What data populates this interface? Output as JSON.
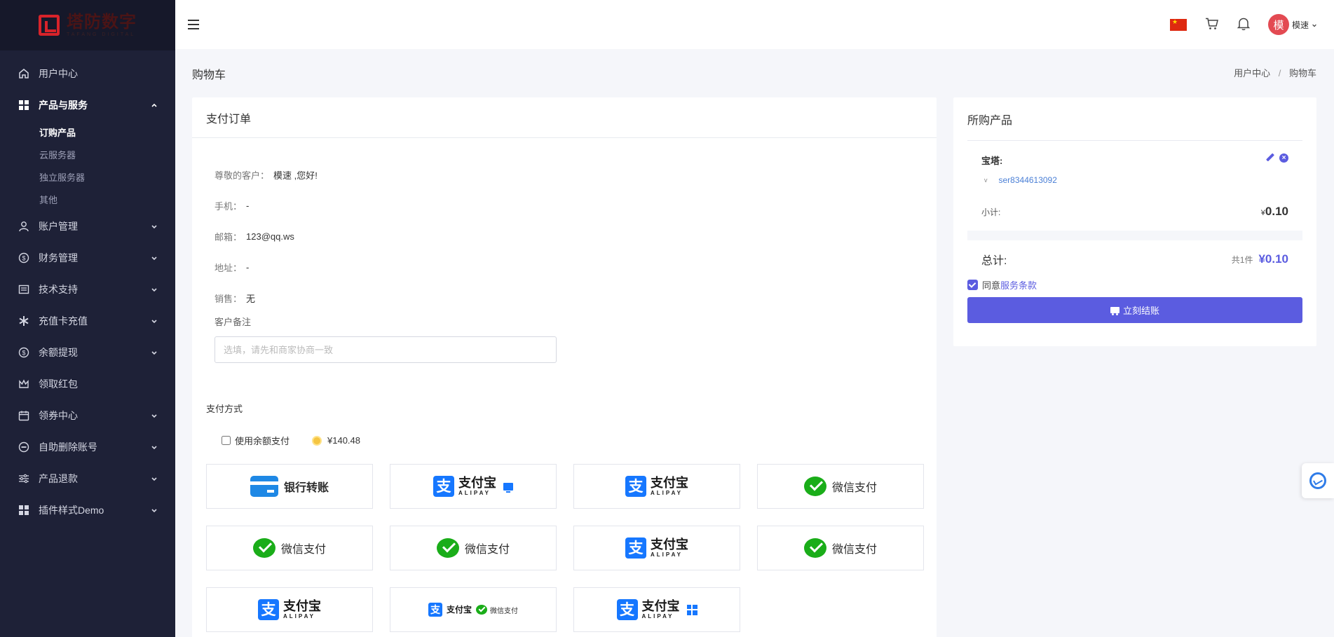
{
  "sidebar": {
    "logo_text": "塔防数字",
    "logo_sub": "TAFANG DIGITAL",
    "items": [
      {
        "label": "用户中心",
        "icon": "home-icon"
      },
      {
        "label": "产品与服务",
        "icon": "grid-icon"
      },
      {
        "label": "账户管理",
        "icon": "user-icon"
      },
      {
        "label": "财务管理",
        "icon": "dollar-icon"
      },
      {
        "label": "技术支持",
        "icon": "ticket-icon"
      },
      {
        "label": "充值卡充值",
        "icon": "asterisk-icon"
      },
      {
        "label": "余额提现",
        "icon": "dollar-icon"
      },
      {
        "label": "领取红包",
        "icon": "crown-icon"
      },
      {
        "label": "领券中心",
        "icon": "calendar-icon"
      },
      {
        "label": "自助删除账号",
        "icon": "minus-circle-icon"
      },
      {
        "label": "产品退款",
        "icon": "sliders-icon"
      },
      {
        "label": "插件样式Demo",
        "icon": "grid-icon"
      }
    ],
    "sub_items": [
      "订购产品",
      "云服务器",
      "独立服务器",
      "其他"
    ]
  },
  "topbar": {
    "avatar_char": "模",
    "username": "模速"
  },
  "page": {
    "title": "购物车",
    "breadcrumb_1": "用户中心",
    "breadcrumb_sep": "/",
    "breadcrumb_2": "购物车"
  },
  "order": {
    "title": "支付订单",
    "greeting_label": "尊敬的客户：",
    "greeting_value": "模速 ,您好!",
    "phone_label": "手机：",
    "phone_value": "-",
    "email_label": "邮箱：",
    "email_value": "123@qq.ws",
    "address_label": "地址：",
    "address_value": "-",
    "sales_label": "销售：",
    "sales_value": "无",
    "remark_label": "客户备注",
    "remark_placeholder": "选填，请先和商家协商一致",
    "pay_title": "支付方式",
    "balance_label": "使用余额支付",
    "balance_value": "¥140.48"
  },
  "payments": {
    "bank": "银行转账",
    "alipay_cn": "支付宝",
    "alipay_en": "ALIPAY",
    "wechat": "微信支付"
  },
  "cart": {
    "title": "所购产品",
    "product_name": "宝塔:",
    "product_code": "ser8344613092",
    "subtotal_label": "小计:",
    "subtotal_currency": "¥",
    "subtotal_value": "0.10",
    "total_label": "总计:",
    "total_count": "共1件",
    "total_value": "¥0.10",
    "agree_text": "同意",
    "terms_text": "服务条款",
    "checkout_label": "立刻结账"
  },
  "colors": {
    "accent": "#5b5ce0",
    "sidebar_bg": "#1e2137",
    "alipay_blue": "#1677ff",
    "wechat_green": "#1aad19"
  }
}
